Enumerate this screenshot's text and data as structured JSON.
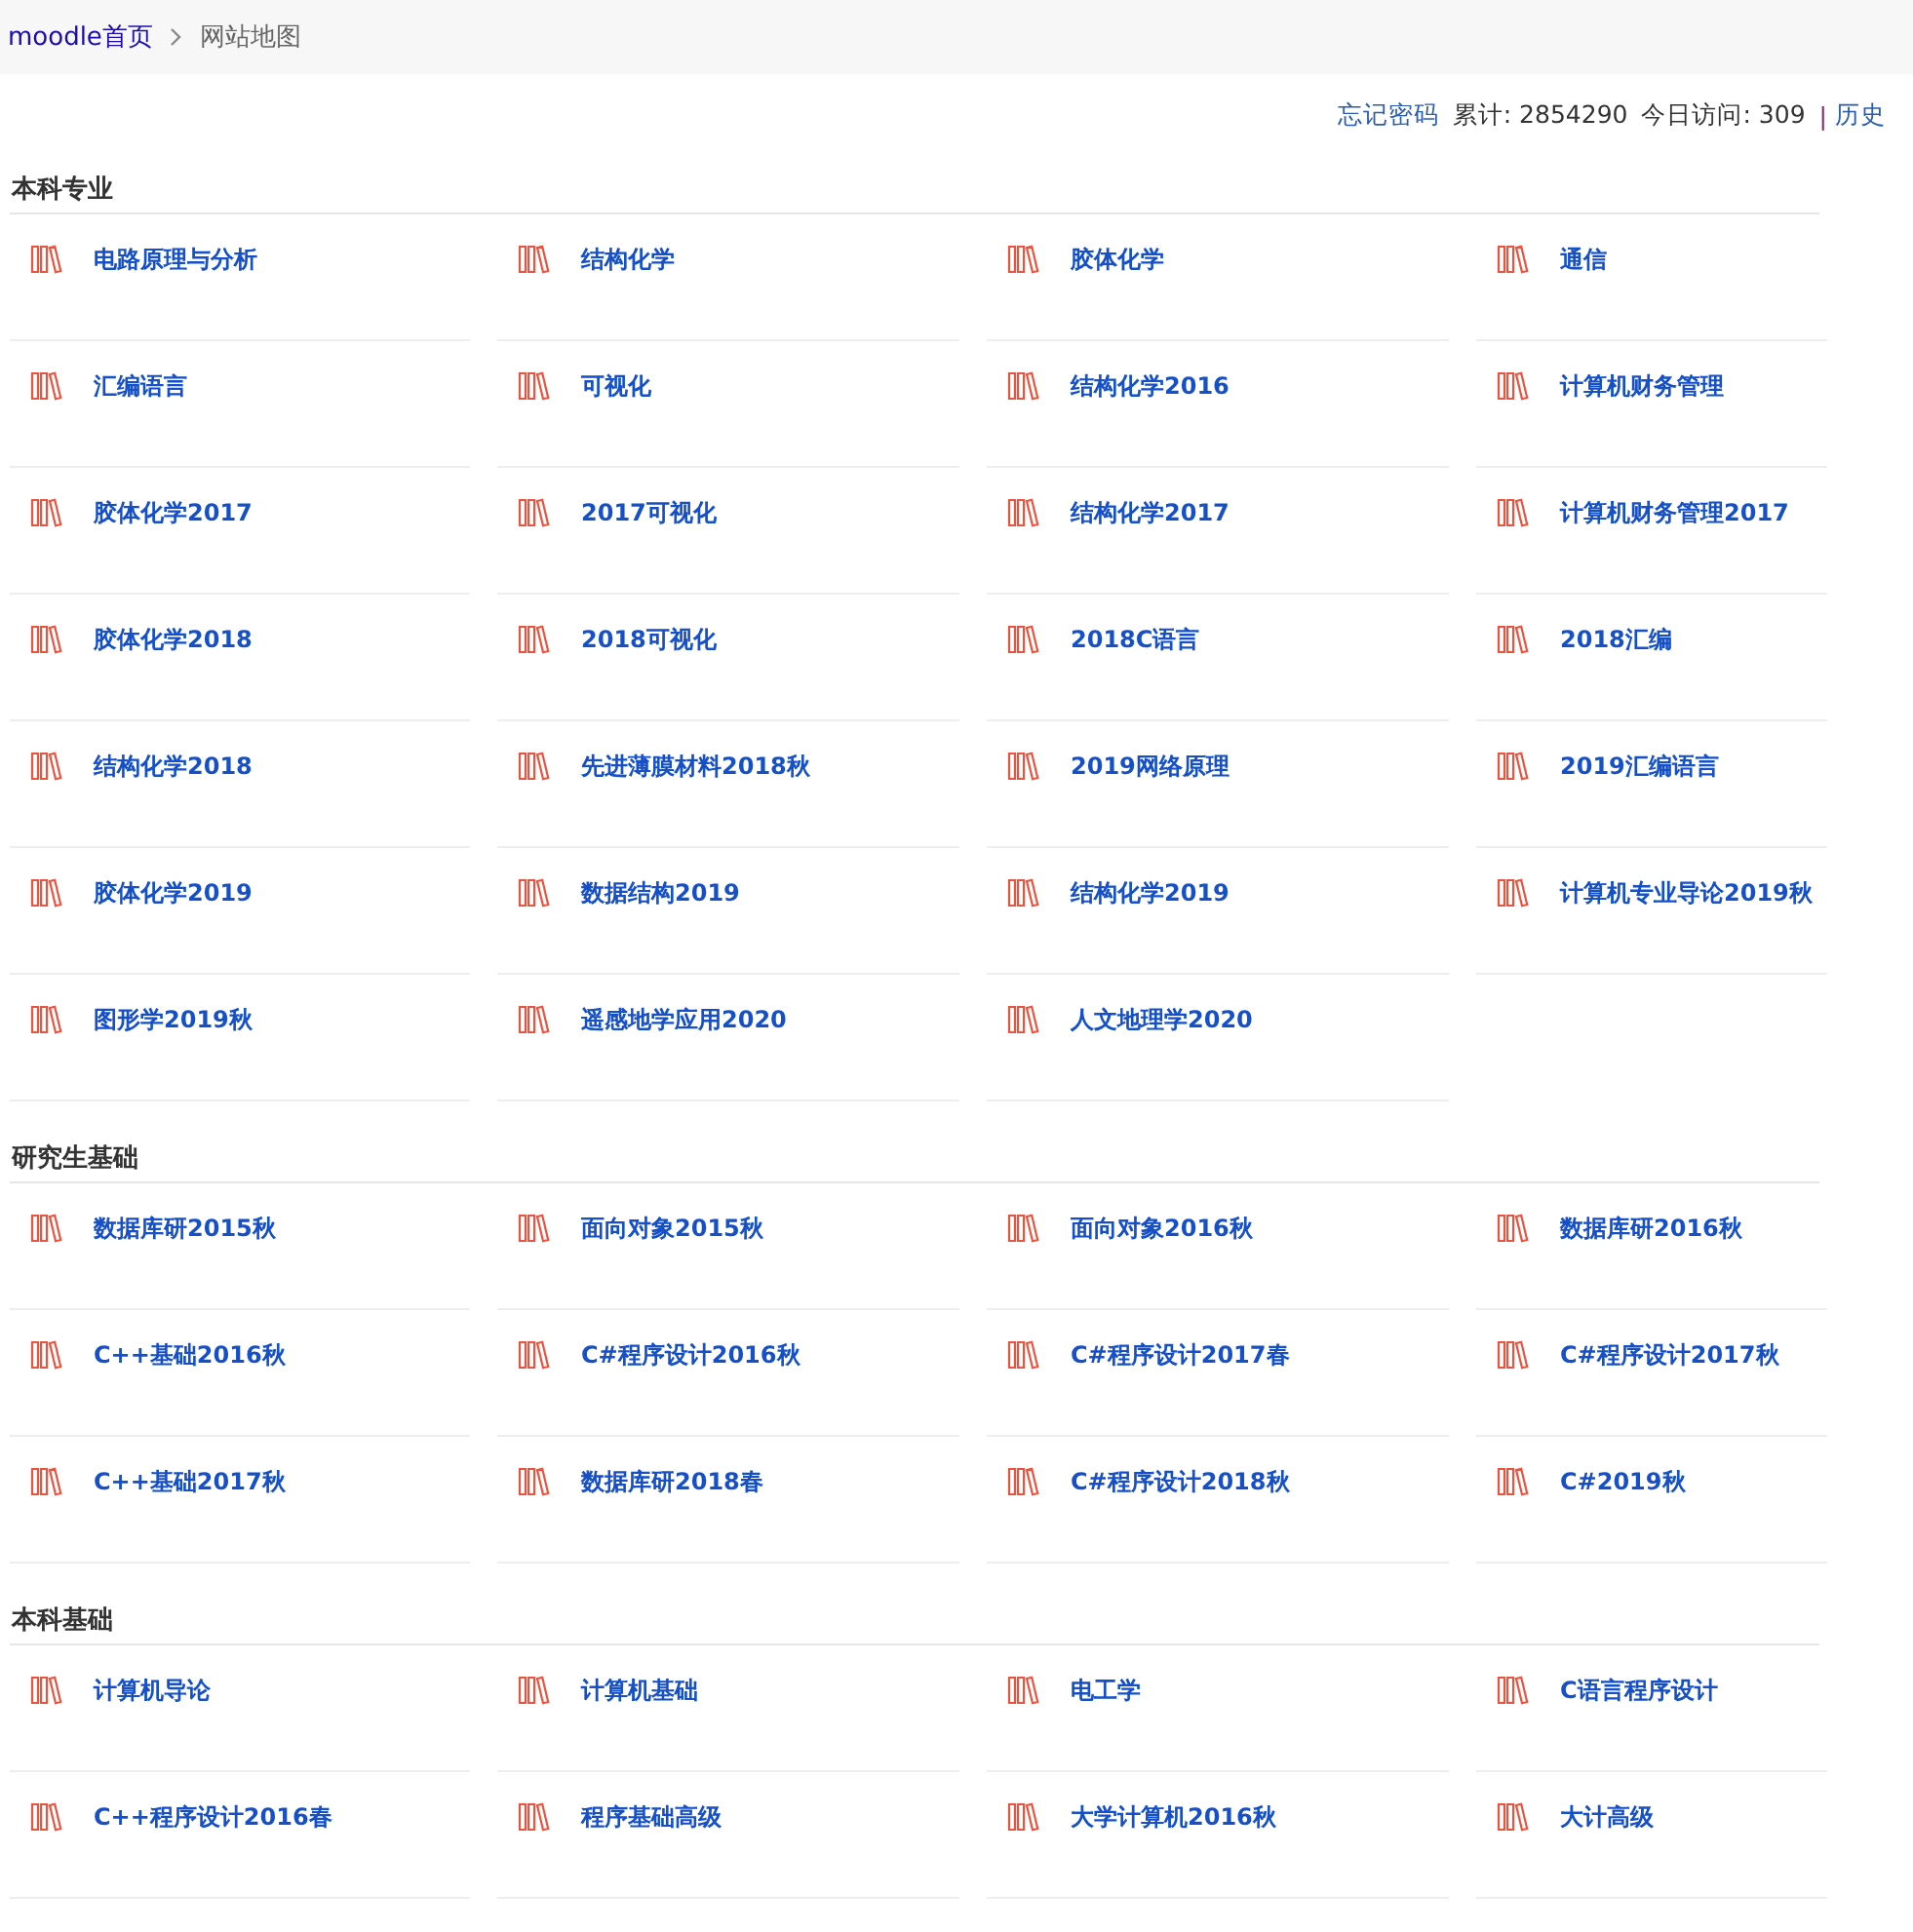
{
  "breadcrumb": [
    {
      "label": "moodle首页",
      "kind": "link"
    },
    {
      "label": "网站地图",
      "kind": "current"
    }
  ],
  "stats": {
    "forgot_password": "忘记密码",
    "total": "累计: 2854290",
    "today": "今日访问: 309",
    "separator": "|",
    "history": "历史"
  },
  "sections": [
    {
      "title": "本科专业",
      "courses": [
        "电路原理与分析",
        "结构化学",
        "胶体化学",
        "通信",
        "汇编语言",
        "可视化",
        "结构化学2016",
        "计算机财务管理",
        "胶体化学2017",
        "2017可视化",
        "结构化学2017",
        "计算机财务管理2017",
        "胶体化学2018",
        "2018可视化",
        "2018C语言",
        "2018汇编",
        "结构化学2018",
        "先进薄膜材料2018秋",
        "2019网络原理",
        "2019汇编语言",
        "胶体化学2019",
        "数据结构2019",
        "结构化学2019",
        "计算机专业导论2019秋",
        "图形学2019秋",
        "遥感地学应用2020",
        "人文地理学2020"
      ]
    },
    {
      "title": "研究生基础",
      "courses": [
        "数据库研2015秋",
        "面向对象2015秋",
        "面向对象2016秋",
        "数据库研2016秋",
        "C++基础2016秋",
        "C#程序设计2016秋",
        "C#程序设计2017春",
        "C#程序设计2017秋",
        "C++基础2017秋",
        "数据库研2018春",
        "C#程序设计2018秋",
        "C#2019秋"
      ]
    },
    {
      "title": "本科基础",
      "courses": [
        "计算机导论",
        "计算机基础",
        "电工学",
        "C语言程序设计",
        "C++程序设计2016春",
        "程序基础高级",
        "大学计算机2016秋",
        "大计高级"
      ]
    }
  ]
}
